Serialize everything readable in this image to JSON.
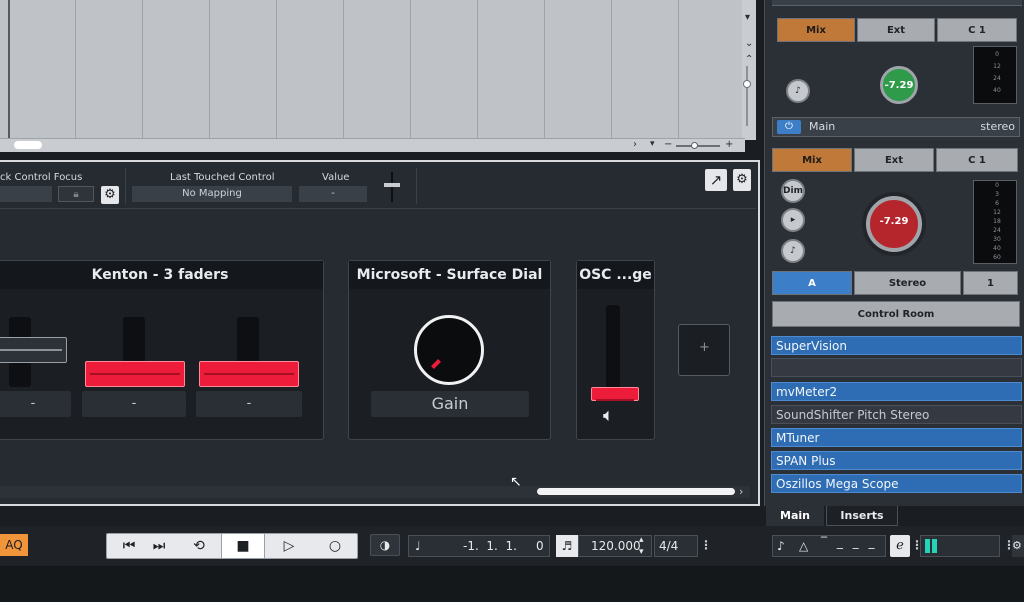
{
  "remote": {
    "track_control_focus_label": "ck Control Focus",
    "last_touched_label": "Last Touched Control",
    "last_touched_value": "No Mapping",
    "value_label": "Value",
    "value_value": "-",
    "cards": [
      {
        "title": "Kenton - 3 faders",
        "values": [
          "-",
          "-",
          "-"
        ]
      },
      {
        "title": "Microsoft - Surface Dial",
        "value": "Gain"
      },
      {
        "title": "OSC ...ge"
      }
    ],
    "add_label": "+"
  },
  "mixer": {
    "top_buttons": [
      "Mix",
      "Ext",
      "C 1"
    ],
    "top_knob_value": "-7.29",
    "main_label": "Main",
    "main_format": "stereo",
    "main_buttons": [
      "Mix",
      "Ext",
      "C 1"
    ],
    "round_buttons": [
      "Dim"
    ],
    "main_knob_value": "-7.29",
    "meter_ticks": [
      "0",
      "12",
      "24",
      "40"
    ],
    "meter_ticks_main": [
      "0",
      "3",
      "6",
      "12",
      "18",
      "24",
      "30",
      "40",
      "60"
    ],
    "channel_buttons": [
      "A",
      "Stereo",
      "1"
    ],
    "control_room_label": "Control Room",
    "plugins": [
      {
        "name": "SuperVision",
        "style": "blue"
      },
      {
        "name": "",
        "style": "gray"
      },
      {
        "name": "mvMeter2",
        "style": "blue"
      },
      {
        "name": "SoundShifter Pitch Stereo",
        "style": "gray"
      },
      {
        "name": "MTuner",
        "style": "blue"
      },
      {
        "name": "SPAN Plus",
        "style": "blue"
      },
      {
        "name": "Oszillos Mega Scope",
        "style": "blue"
      }
    ],
    "tabs": [
      "Main",
      "Inserts"
    ]
  },
  "transport": {
    "aq_label": "AQ",
    "position": "-1.  1.  1.     0",
    "tempo": "120.000",
    "signature": "4/4"
  },
  "colors": {
    "fader_red": "#ec1c3a",
    "accent_orange": "#c1793a",
    "plugin_blue": "#2e6db4"
  }
}
